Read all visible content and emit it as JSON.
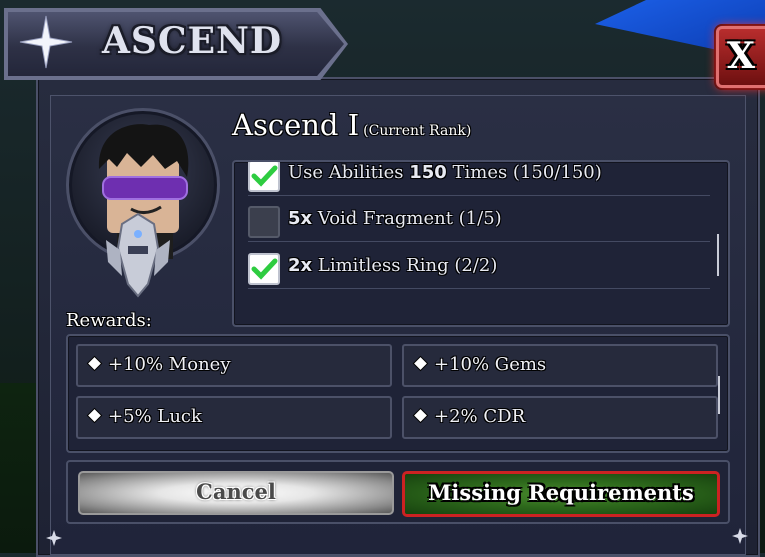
{
  "window": {
    "title": "ASCEND",
    "close_label": "X"
  },
  "rank": {
    "name": "Ascend I",
    "subtitle": "(Current Rank)"
  },
  "requirements": [
    {
      "count": "",
      "bold": "Use Abilities ",
      "bold_num": "150",
      "text": " Times (150/150)",
      "done": true
    },
    {
      "bold_num": "5x",
      "text": " Void Fragment (1/5)",
      "done": false
    },
    {
      "bold_num": "2x",
      "text": " Limitless Ring (2/2)",
      "done": true
    }
  ],
  "rewards": {
    "label": "Rewards:",
    "items": [
      "+10% Money",
      "+10% Gems",
      "+5% Luck",
      "+2% CDR"
    ]
  },
  "buttons": {
    "cancel": "Cancel",
    "missing": "Missing Requirements"
  },
  "colors": {
    "check": "#2ecc40",
    "danger_border": "#cc2222",
    "close_bg": "#b82d2d"
  }
}
